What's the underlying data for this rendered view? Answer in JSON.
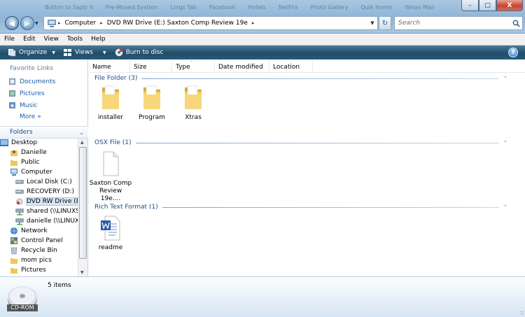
{
  "window": {
    "background_tabs": [
      "Button to Saptr II",
      "Pre-Moved System",
      "Lorgs Tab",
      "Facebook",
      "Hotels",
      "NetFlix",
      "Photo Gallery",
      "Quik Home",
      "Yahoo Mail"
    ],
    "min_label": "–",
    "max_label": "□",
    "close_label": "X"
  },
  "address": {
    "crumbs": [
      "Computer",
      "DVD RW Drive (E:) Saxton Comp Review 19e"
    ],
    "separator": "▸"
  },
  "search": {
    "placeholder": "Search"
  },
  "menu": [
    "File",
    "Edit",
    "View",
    "Tools",
    "Help"
  ],
  "commands": {
    "organize": "Organize",
    "views": "Views",
    "burn": "Burn to disc"
  },
  "nav": {
    "favorites_header": "Favorite Links",
    "favorites": [
      {
        "label": "Documents",
        "icon": "documents-icon"
      },
      {
        "label": "Pictures",
        "icon": "pictures-icon"
      },
      {
        "label": "Music",
        "icon": "music-icon"
      }
    ],
    "more": "More",
    "more_chevron": "»",
    "folders_header": "Folders",
    "tree": [
      {
        "label": "Desktop",
        "icon": "desktop-icon"
      },
      {
        "label": "Danielle",
        "icon": "user-folder-icon"
      },
      {
        "label": "Public",
        "icon": "folder-icon"
      },
      {
        "label": "Computer",
        "icon": "computer-icon"
      },
      {
        "label": "Local Disk (C:)",
        "icon": "hard-disk-icon"
      },
      {
        "label": "RECOVERY (D:)",
        "icon": "hard-disk-icon"
      },
      {
        "label": "DVD RW Drive (E:)",
        "icon": "dvd-drive-icon"
      },
      {
        "label": "shared (\\\\LINUXSE",
        "icon": "network-drive-icon"
      },
      {
        "label": "danielle (\\\\LINUXS",
        "icon": "network-drive-icon"
      },
      {
        "label": "Network",
        "icon": "network-icon"
      },
      {
        "label": "Control Panel",
        "icon": "control-panel-icon"
      },
      {
        "label": "Recycle Bin",
        "icon": "recycle-bin-icon"
      },
      {
        "label": "mom pics",
        "icon": "folder-icon"
      },
      {
        "label": "Pictures",
        "icon": "folder-icon"
      }
    ]
  },
  "columns": [
    "Name",
    "Size",
    "Type",
    "Date modified",
    "Location"
  ],
  "groups": [
    {
      "title": "File Folder (3)",
      "items": [
        {
          "label": "installer",
          "icon": "folder-icon"
        },
        {
          "label": "Program",
          "icon": "folder-icon"
        },
        {
          "label": "Xtras",
          "icon": "folder-icon"
        }
      ]
    },
    {
      "title": "OSX File (1)",
      "items": [
        {
          "label": "Saxton Comp Review 19e....",
          "icon": "blank-file-icon"
        }
      ]
    },
    {
      "title": "Rich Text Format (1)",
      "items": [
        {
          "label": "readme",
          "icon": "word-document-icon"
        }
      ]
    }
  ],
  "details": {
    "drive_label": "CD-ROM",
    "item_count": "5 items"
  },
  "colors": {
    "command_bar": "#1f4e6b",
    "link": "#1d5aa8",
    "group_header": "#1f4b7c",
    "folder": "#f0c85a"
  }
}
